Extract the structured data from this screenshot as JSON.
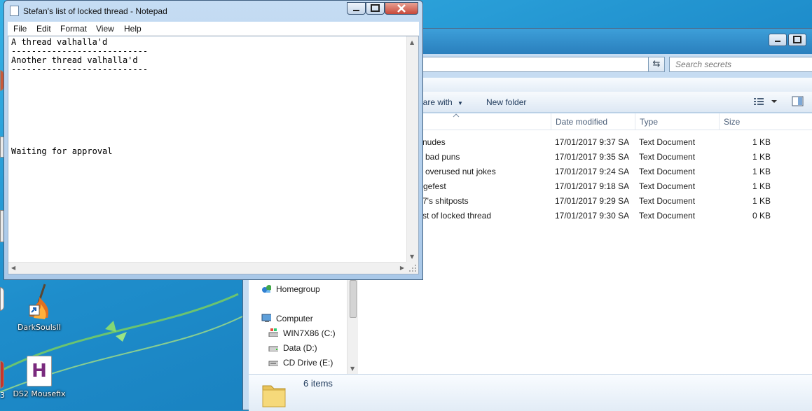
{
  "notepad": {
    "title": "Stefan's list of locked thread - Notepad",
    "menu": [
      "File",
      "Edit",
      "Format",
      "View",
      "Help"
    ],
    "content": "A thread valhalla'd\n---------------------------\nAnother thread valhalla'd\n---------------------------\n\n\n\n\n\n\n\n\nWaiting for approval"
  },
  "explorer": {
    "search_placeholder": "Search secrets",
    "toolbar": {
      "share": "hare with",
      "new_folder": "New folder"
    },
    "columns": [
      "Date modified",
      "Type",
      "Size"
    ],
    "files": [
      {
        "name": "nudes",
        "date": "17/01/2017 9:37 SA",
        "type": "Text Document",
        "size": "1 KB"
      },
      {
        "name": "bad puns",
        "date": "17/01/2017 9:35 SA",
        "type": "Text Document",
        "size": "1 KB"
      },
      {
        "name": "overused nut jokes",
        "date": "17/01/2017 9:24 SA",
        "type": "Text Document",
        "size": "1 KB"
      },
      {
        "name": "gefest",
        "date": "17/01/2017 9:18 SA",
        "type": "Text Document",
        "size": "1 KB"
      },
      {
        "name": "7's shitposts",
        "date": "17/01/2017 9:29 SA",
        "type": "Text Document",
        "size": "1 KB"
      },
      {
        "name": "st of locked thread",
        "date": "17/01/2017 9:30 SA",
        "type": "Text Document",
        "size": "0 KB"
      }
    ],
    "nav": {
      "homegroup": "Homegroup",
      "computer": "Computer",
      "drives": [
        "WIN7X86 (C:)",
        "Data (D:)",
        "CD Drive (E:)"
      ]
    },
    "status": "6 items"
  },
  "desktop": {
    "icons": [
      {
        "label": "DarkSoulsII"
      },
      {
        "label": "DS2 Mousefix",
        "glyph": "H"
      }
    ],
    "edge_label": "3"
  }
}
